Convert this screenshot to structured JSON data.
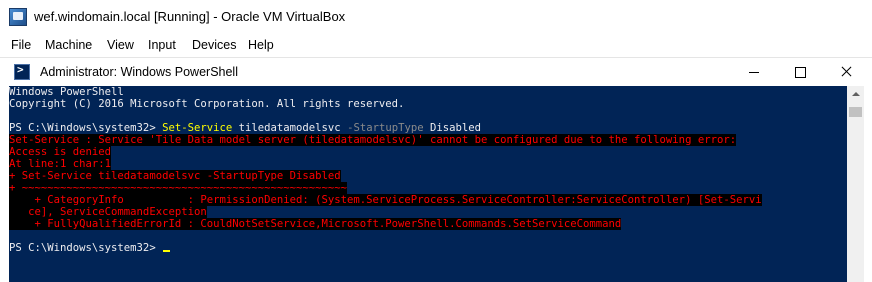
{
  "vbox": {
    "title": "wef.windomain.local [Running] - Oracle VM VirtualBox",
    "icon": "virtualbox-vm-icon",
    "menu": [
      "File",
      "Machine",
      "View",
      "Input",
      "Devices",
      "Help"
    ]
  },
  "powershell": {
    "title": "Administrator: Windows PowerShell",
    "icon": "powershell-icon",
    "colors": {
      "background": "#012456",
      "text": "#eeedf0",
      "command": "#ffff00",
      "parameter": "#8a8a8a",
      "error": "#ff0000",
      "error_background": "#000000"
    },
    "banner": [
      "Windows PowerShell",
      "Copyright (C) 2016 Microsoft Corporation. All rights reserved."
    ],
    "command_line": {
      "prompt": "PS C:\\Windows\\system32> ",
      "cmdlet": "Set-Service",
      "arg1": " tiledatamodelsvc ",
      "param": "-StartupType",
      "arg2": " Disabled"
    },
    "error_lines": [
      "Set-Service : Service 'Tile Data model server (tiledatamodelsvc)' cannot be configured due to the following error:",
      "Access is denied",
      "At line:1 char:1",
      "+ Set-Service tiledatamodelsvc -StartupType Disabled",
      "+ ~~~~~~~~~~~~~~~~~~~~~~~~~~~~~~~~~~~~~~~~~~~~~~~~~~~",
      "    + CategoryInfo          : PermissionDenied: (System.ServiceProcess.ServiceController:ServiceController) [Set-Servi",
      "   ce], ServiceCommandException",
      "    + FullyQualifiedErrorId : CouldNotSetService,Microsoft.PowerShell.Commands.SetServiceCommand"
    ],
    "final_prompt": "PS C:\\Windows\\system32> "
  }
}
